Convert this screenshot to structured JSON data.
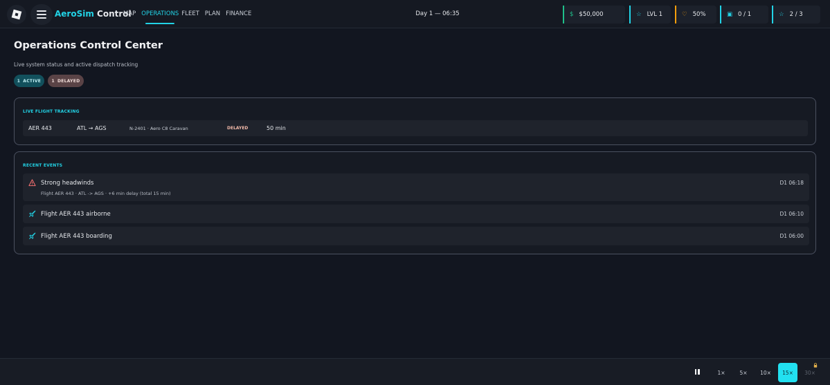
{
  "topbar": {
    "brand_primary": "AeroSim",
    "brand_secondary": "Control",
    "nav": [
      "MAP",
      "OPERATIONS",
      "FLEET",
      "PLAN",
      "FINANCE"
    ],
    "active_nav": "OPERATIONS",
    "clock": "Day 1 — 06:35",
    "stats": {
      "money_icon": "$",
      "money": "$50,000",
      "level_icon": "☆",
      "level": "LVL 1",
      "reputation_icon": "♡",
      "reputation": "50%",
      "tickets_icon": "▣",
      "tickets": "0 / 1",
      "stars_icon": "☆",
      "stars": "2 / 3"
    }
  },
  "header": {
    "title": "Operations Control Center",
    "subtitle": "Live system status and active dispatch tracking",
    "pills": {
      "active_count": "1",
      "active_label": "ACTIVE",
      "delayed_count": "1",
      "delayed_label": "DELAYED"
    }
  },
  "tracking": {
    "title": "LIVE FLIGHT TRACKING",
    "flights": [
      {
        "code": "AER 443",
        "route": "ATL → AGS",
        "aircraft": "N-2401 · Aero C8 Caravan",
        "status": "DELAYED",
        "delay": "50 min"
      }
    ]
  },
  "events": {
    "title": "RECENT EVENTS",
    "items": [
      {
        "icon": "warning-icon",
        "title": "Strong headwinds",
        "detail": "Flight AER 443 · ATL -> AGS · +6 min delay (total 15 min)",
        "time": "D1 06:18"
      },
      {
        "icon": "plane-icon",
        "title": "Flight AER 443 airborne",
        "detail": "",
        "time": "D1 06:10"
      },
      {
        "icon": "plane-icon",
        "title": "Flight AER 443 boarding",
        "detail": "",
        "time": "D1 06:00"
      }
    ]
  },
  "speed": {
    "options": [
      "1×",
      "5×",
      "10×",
      "15×",
      "30×"
    ],
    "selected": "15×",
    "locked": "30×"
  },
  "colors": {
    "accent": "#22d3e6",
    "money": "#1fc08a",
    "reputation": "#f59e0b",
    "delayed": "#f0b8a8",
    "warning": "#f87171"
  }
}
